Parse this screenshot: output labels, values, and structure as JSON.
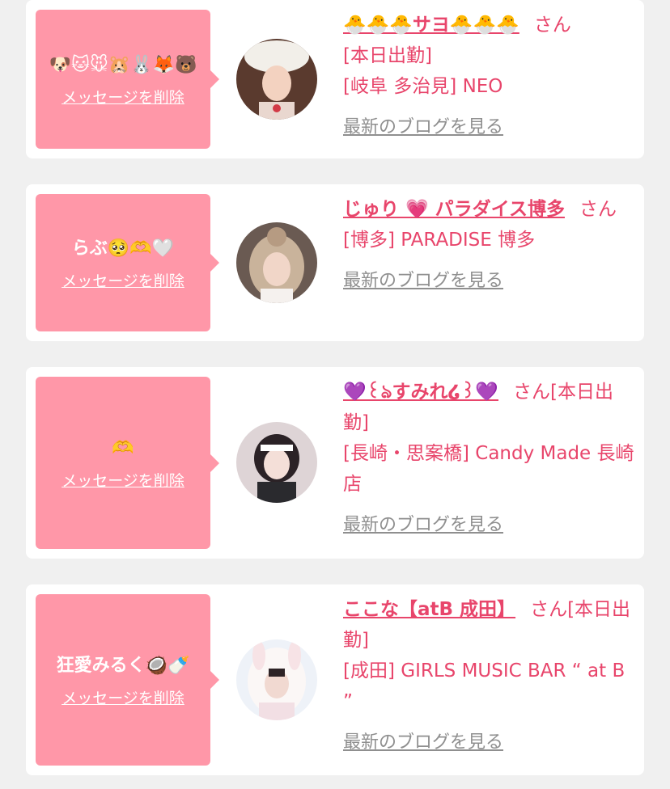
{
  "items": [
    {
      "message": "🐶🐱🐭🐹🐰🦊🐻",
      "delete_label": "メッセージを削除",
      "name": "🐣🐣🐣サヨ🐣🐣🐣",
      "honorific": "さん",
      "status": "[本日出勤]",
      "shop": "[岐阜 多治見] NEO",
      "blog_label": "最新のブログを見る"
    },
    {
      "message": "らぶ🥺🫶🤍",
      "delete_label": "メッセージを削除",
      "name": "じゅり 💗 パラダイス博多",
      "honorific": "さん",
      "status": "",
      "shop": "[博多] PARADISE 博多",
      "blog_label": "最新のブログを見る"
    },
    {
      "message": "🫶",
      "delete_label": "メッセージを削除",
      "name": "💜꒰ঌすみれ໒꒱💜",
      "honorific": "さん",
      "status": "[本日出勤]",
      "shop": "[長崎・思案橋] Candy Made 長崎店",
      "blog_label": "最新のブログを見る"
    },
    {
      "message": "狂愛みるく🥥🍼",
      "delete_label": "メッセージを削除",
      "name": "ここな【atB 成田】",
      "honorific": "さん",
      "status": "[本日出勤]",
      "shop": "[成田] GIRLS MUSIC BAR “ at B ”",
      "blog_label": "最新のブログを見る"
    }
  ],
  "colors": {
    "accent": "#e8456b",
    "bubble": "#ff97a8",
    "background": "#f0f0f0",
    "muted": "#8f8f8f"
  }
}
